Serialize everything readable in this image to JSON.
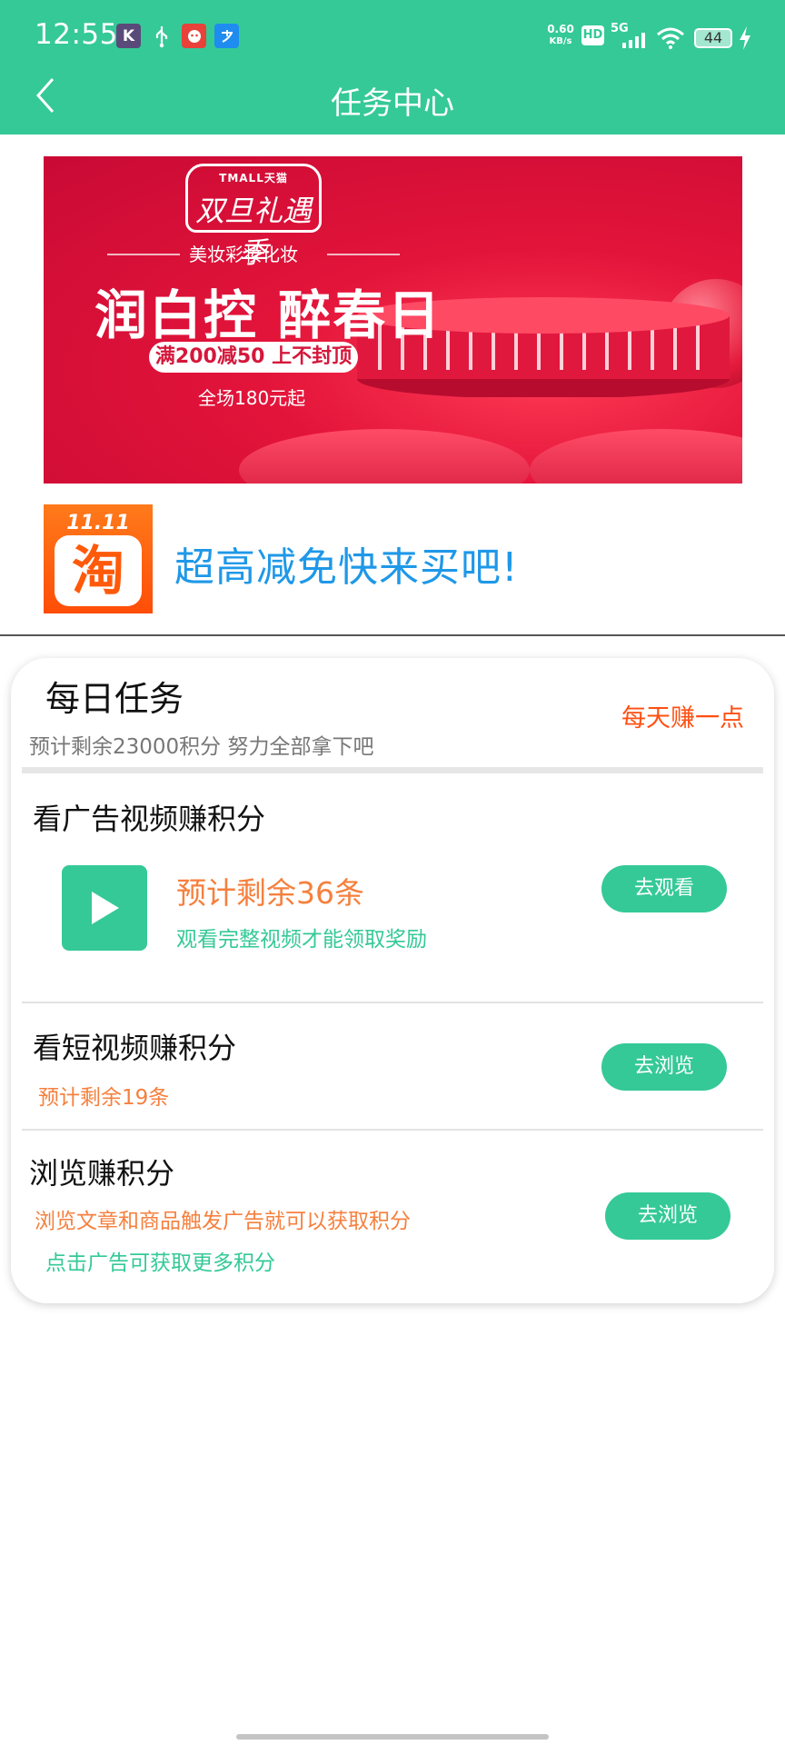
{
  "status_bar": {
    "time": "12:55",
    "net_speed_value": "0.60",
    "net_speed_unit": "KB/s",
    "hd_label": "HD",
    "network_label": "5G",
    "battery_level": "44"
  },
  "header": {
    "title": "任务中心"
  },
  "banner": {
    "brand_small": "TMALL天猫",
    "brand_logo_text": "双旦礼遇季",
    "subtitle": "美妆彩妆化妆",
    "headline": "润白控  醉春日",
    "offer": "满200减50 上不封顶",
    "footer": "全场180元起"
  },
  "promo": {
    "logo_date": "11.11",
    "logo_char": "淘",
    "text": "超高减免快来买吧!"
  },
  "daily_tasks": {
    "title": "每日任务",
    "subtitle": "预计剩余23000积分 努力全部拿下吧",
    "side_link": "每天赚一点"
  },
  "tasks": [
    {
      "title": "看广告视频赚积分",
      "remaining": "预计剩余36条",
      "note": "观看完整视频才能领取奖励",
      "button": "去观看"
    },
    {
      "title": "看短视频赚积分",
      "remaining": "预计剩余19条",
      "button": "去浏览"
    },
    {
      "title": "浏览赚积分",
      "note1": "浏览文章和商品触发广告就可以获取积分",
      "note2": "点击广告可获取更多积分",
      "button": "去浏览"
    }
  ],
  "colors": {
    "primary": "#35c997",
    "accent_orange": "#f5803e",
    "link_red": "#ff4f12",
    "promo_blue": "#1f98e8",
    "banner_red": "#d5173b"
  },
  "icons": {
    "back": "chevron-left-icon",
    "play": "play-icon",
    "wifi": "wifi-icon",
    "signal": "signal-icon",
    "charging": "bolt-icon"
  }
}
